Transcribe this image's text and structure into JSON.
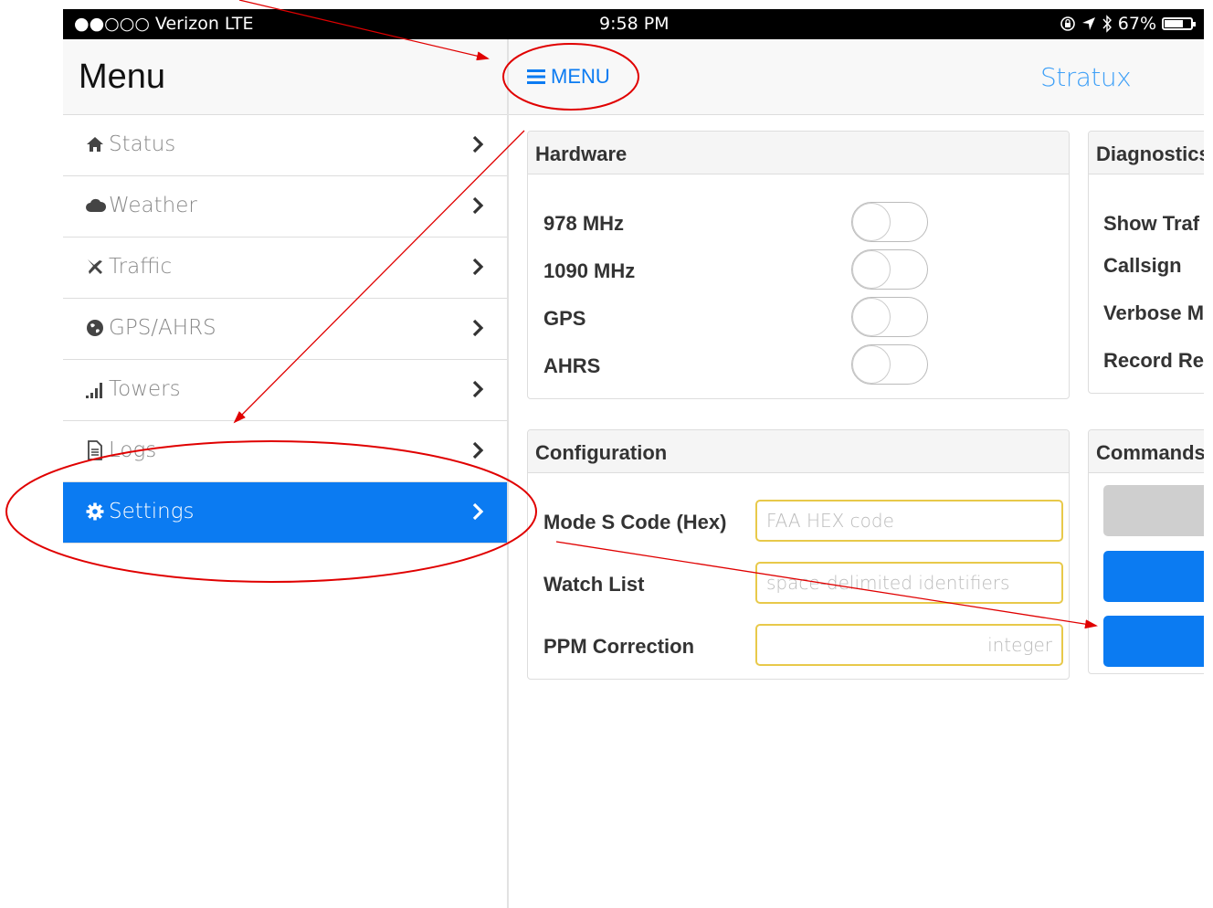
{
  "statusbar": {
    "carrier": "●●○○○ Verizon  LTE",
    "time": "9:58 PM",
    "battery": "67%",
    "battery_level": 0.67
  },
  "sidebar": {
    "title": "Menu",
    "items": [
      {
        "label": "Status",
        "icon": "home-icon"
      },
      {
        "label": "Weather",
        "icon": "cloud-icon"
      },
      {
        "label": "Traffic",
        "icon": "plane-icon"
      },
      {
        "label": "GPS/AHRS",
        "icon": "globe-icon"
      },
      {
        "label": "Towers",
        "icon": "signal-icon"
      },
      {
        "label": "Logs",
        "icon": "document-icon"
      },
      {
        "label": "Settings",
        "icon": "gear-icon",
        "active": true
      }
    ]
  },
  "navbar": {
    "menu_label": "MENU",
    "brand": "Stratux"
  },
  "hardware": {
    "title": "Hardware",
    "rows": [
      {
        "label": "978 MHz",
        "on": false
      },
      {
        "label": "1090 MHz",
        "on": false
      },
      {
        "label": "GPS",
        "on": false
      },
      {
        "label": "AHRS",
        "on": false
      }
    ]
  },
  "diagnostics": {
    "title": "Diagnostics",
    "rows": [
      "Show Traf",
      "Callsign",
      "Verbose M",
      "Record Re"
    ]
  },
  "configuration": {
    "title": "Configuration",
    "mode_s_label": "Mode S Code (Hex)",
    "mode_s_placeholder": "FAA HEX code",
    "watch_label": "Watch List",
    "watch_placeholder": "space-delimited identifiers",
    "ppm_label": "PPM Correction",
    "ppm_placeholder": "integer"
  },
  "commands": {
    "title": "Commands"
  },
  "colors": {
    "accent": "#0b7bf2",
    "annotation": "#e00000",
    "field_border": "#e8c94a"
  }
}
